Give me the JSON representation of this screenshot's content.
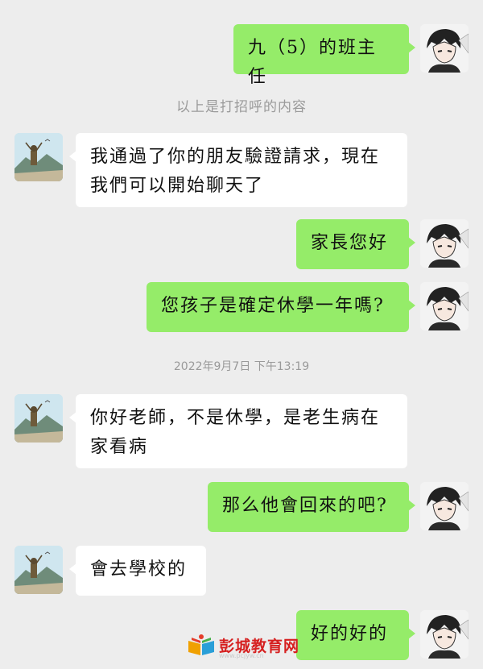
{
  "conversation": {
    "messages": [
      {
        "sender": "me",
        "text": "九（5）的班主任"
      },
      {
        "sender": "parent",
        "text": "我通過了你的朋友驗證請求，現在我們可以開始聊天了"
      },
      {
        "sender": "me",
        "text": "家長您好"
      },
      {
        "sender": "me",
        "text": "您孩子是確定休學一年嗎?"
      },
      {
        "sender": "parent",
        "text": "你好老師，不是休學，是老生病在家看病"
      },
      {
        "sender": "me",
        "text": "那么他會回來的吧?"
      },
      {
        "sender": "parent",
        "text": "會去學校的"
      },
      {
        "sender": "me",
        "text": "好的好的"
      }
    ],
    "system_note": "以上是打招呼的内容",
    "timestamp": "2022年9月7日 下午13:19"
  },
  "watermark": {
    "text": "彭城教育网",
    "url": "www.pcjyw.cn"
  },
  "colors": {
    "background": "#ededed",
    "self_bubble": "#95ec69",
    "other_bubble": "#ffffff",
    "system_text": "#9a9a9a",
    "watermark_text": "#d62020"
  },
  "icons": {
    "self_avatar": "anime-boy-avatar-icon",
    "parent_avatar": "landscape-figure-avatar-icon",
    "watermark_logo": "book-logo-icon"
  }
}
